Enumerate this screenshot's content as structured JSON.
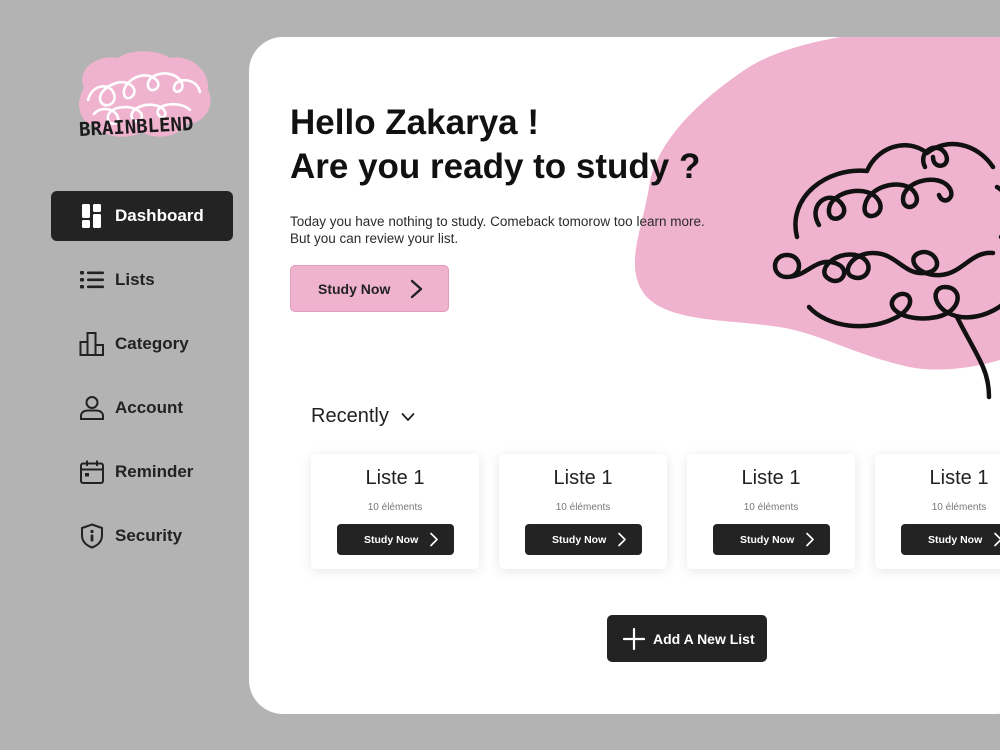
{
  "brand": {
    "name": "BRAINBLEND",
    "accent_pink": "#f0b3cf",
    "dark": "#232323"
  },
  "sidebar": {
    "items": [
      {
        "label": "Dashboard",
        "icon": "dashboard-icon",
        "active": true
      },
      {
        "label": "Lists",
        "icon": "list-icon",
        "active": false
      },
      {
        "label": "Category",
        "icon": "bar-chart-icon",
        "active": false
      },
      {
        "label": "Account",
        "icon": "user-icon",
        "active": false
      },
      {
        "label": "Reminder",
        "icon": "calendar-icon",
        "active": false
      },
      {
        "label": "Security",
        "icon": "shield-icon",
        "active": false
      }
    ]
  },
  "hero": {
    "greeting_line1": "Hello Zakarya !",
    "greeting_line2": "Are you ready to study ?",
    "subtext_line1": "Today you have nothing to study. Comeback tomorow too learn more.",
    "subtext_line2": "But you can review your list.",
    "cta_label": "Study Now"
  },
  "recently": {
    "label": "Recently",
    "cards": [
      {
        "title": "Liste 1",
        "count": "10 éléments",
        "button": "Study Now"
      },
      {
        "title": "Liste 1",
        "count": "10 éléments",
        "button": "Study Now"
      },
      {
        "title": "Liste 1",
        "count": "10 éléments",
        "button": "Study Now"
      },
      {
        "title": "Liste 1",
        "count": "10 éléments",
        "button": "Study Now"
      }
    ]
  },
  "add_list": {
    "label": "Add A New List"
  }
}
